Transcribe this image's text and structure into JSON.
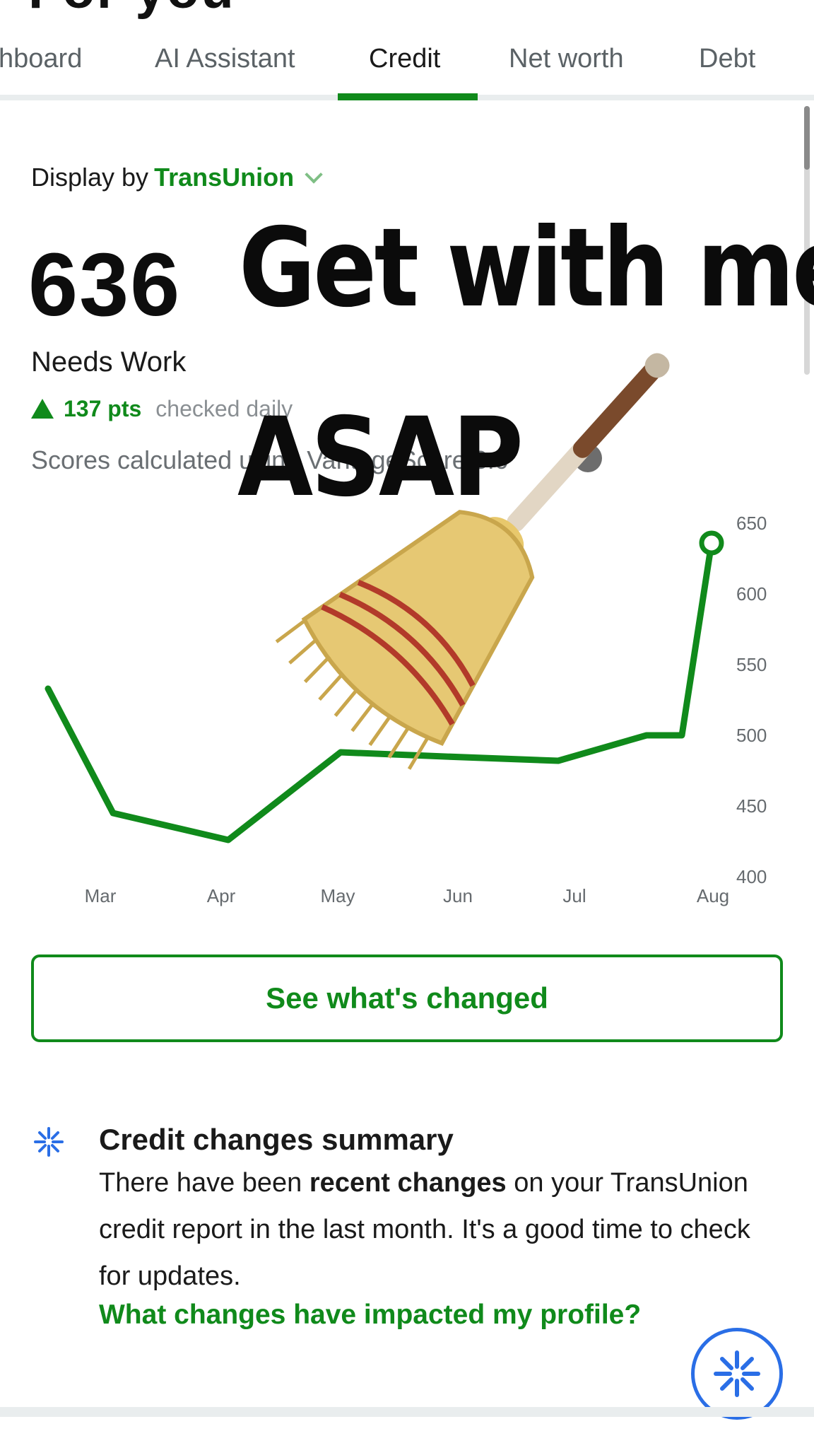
{
  "header": {
    "title_fragment": "For you"
  },
  "tabs": [
    {
      "label": "hboard"
    },
    {
      "label": "AI Assistant"
    },
    {
      "label": "Credit",
      "active": true
    },
    {
      "label": "Net worth"
    },
    {
      "label": "Debt"
    }
  ],
  "score_panel": {
    "display_by_label": "Display by",
    "bureau": "TransUnion",
    "score": "636",
    "rating": "Needs Work",
    "change_pts": "137 pts",
    "checked_text": "checked daily",
    "calc_text": "Scores calculated using VantageScore 3.0"
  },
  "overlay": {
    "line1": "Get with me",
    "line2": "ASAP",
    "emoji": "broom-emoji"
  },
  "chart_data": {
    "type": "line",
    "x": [
      "Mar-start",
      "Mar",
      "Apr",
      "May",
      "Jun",
      "Jul",
      "Aug-start",
      "Aug"
    ],
    "categories": [
      "Mar",
      "Apr",
      "May",
      "Jun",
      "Jul",
      "Aug"
    ],
    "series": [
      {
        "values": [
          533,
          445,
          426,
          488,
          485,
          482,
          500,
          500,
          636
        ]
      }
    ],
    "y_ticks": [
      "650",
      "600",
      "550",
      "500",
      "450",
      "400"
    ],
    "ylim": [
      400,
      650
    ],
    "grid": false,
    "color": "#108a1b"
  },
  "actions": {
    "see_changes": "See what's changed"
  },
  "summary": {
    "title": "Credit changes summary",
    "body_prefix": "There have been ",
    "body_bold": "recent changes",
    "body_suffix": " on your TransUnion credit report in the last month. It's a good time to check for updates.",
    "link": "What changes have impacted my profile?"
  },
  "colors": {
    "brand_green": "#108a1b",
    "assistant_blue": "#2a6ee6"
  },
  "icons": {
    "summary": "sparkle-icon",
    "fab": "ai-sparkle-icon"
  }
}
